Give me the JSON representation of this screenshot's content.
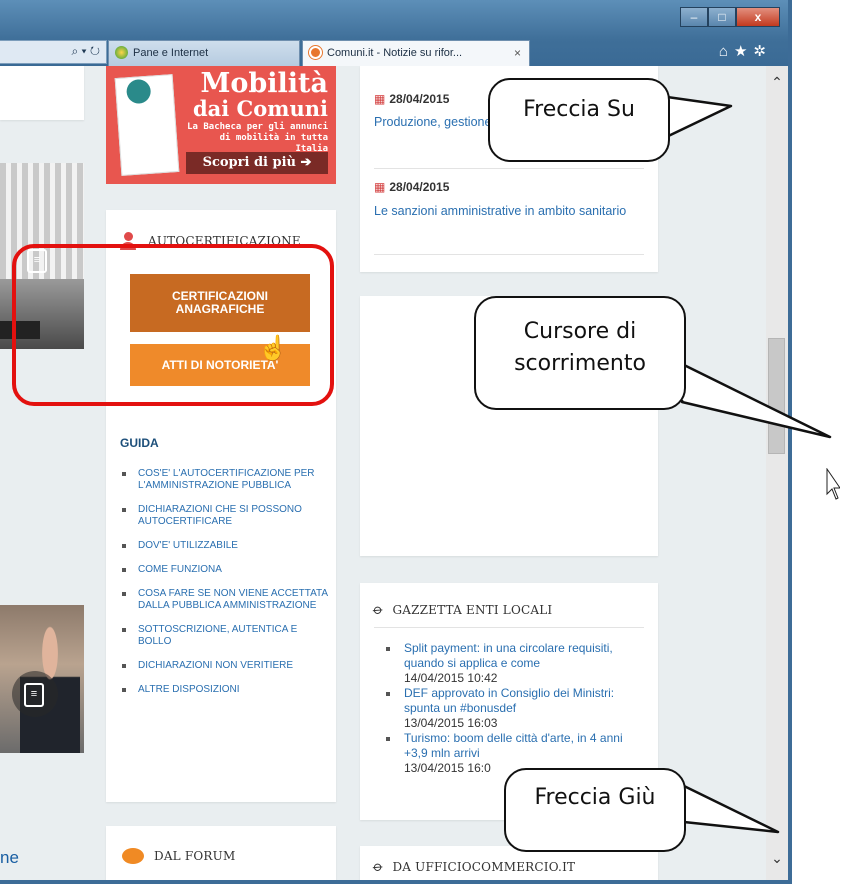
{
  "browser": {
    "address_icons": "⌕ ▾ ↻",
    "tabs": [
      {
        "label": "Pane e Internet",
        "active": false
      },
      {
        "label": "Comuni.it - Notizie su rifor...",
        "active": true,
        "close": "×"
      }
    ],
    "window_buttons": {
      "minimize": "–",
      "maximize": "□",
      "close": "x"
    },
    "toolbar_icons": [
      "home-icon",
      "star-icon",
      "gear-icon"
    ]
  },
  "left_column": {
    "bottom_link": "ne"
  },
  "banner": {
    "title_line1": "Mobilità",
    "title_line2": "dai Comuni",
    "subtitle": "La Bacheca per gli annunci di mobilità in tutta Italia",
    "cta": "Scopri di più ➔",
    "color": "#e8564f"
  },
  "autocertificazione": {
    "title": "AUTOCERTIFICAZIONE",
    "button1": "CERTIFICAZIONI ANAGRAFICHE",
    "button2": "ATTI DI NOTORIETA'",
    "button1_color": "#c76a22",
    "button2_color": "#ef8a2a",
    "guida_title": "GUIDA",
    "guida_items": [
      "COS'E' L'AUTOCERTIFICAZIONE PER L'AMMINISTRAZIONE PUBBLICA",
      "DICHIARAZIONI CHE SI POSSONO AUTOCERTIFICARE",
      "DOV'E' UTILIZZABILE",
      "COME FUNZIONA",
      "COSA FARE SE NON VIENE ACCETTATA DALLA PUBBLICA AMMINISTRAZIONE",
      "SOTTOSCRIZIONE, AUTENTICA E BOLLO",
      "DICHIARAZIONI NON VERITIERE",
      "ALTRE DISPOSIZIONI"
    ]
  },
  "forum": {
    "title": "DAL FORUM"
  },
  "news": [
    {
      "date": "28/04/2015",
      "title": "Produzione, gestione documenti informatici"
    },
    {
      "date": "28/04/2015",
      "title": "Le sanzioni amministrative in ambito sanitario"
    }
  ],
  "gazzetta": {
    "title": "GAZZETTA ENTI LOCALI",
    "items": [
      {
        "title": "Split payment: in una circolare requisiti, quando si applica e come",
        "time": "14/04/2015 10:42"
      },
      {
        "title": "DEF approvato in Consiglio dei Ministri: spunta un #bonusdef",
        "time": "13/04/2015 16:03"
      },
      {
        "title": "Turismo: boom delle città d'arte, in 4 anni +3,9 mln arrivi",
        "time": "13/04/2015 16:0"
      }
    ]
  },
  "ufficio": {
    "title": "DA UFFICIOCOMMERCIO.IT"
  },
  "scrollbar": {
    "up_arrow": "⌃",
    "down_arrow": "⌄",
    "position_fraction": 0.34
  },
  "annotations": {
    "freccia_su": "Freccia Su",
    "cursore": "Cursore di scorrimento",
    "freccia_giu": "Freccia Giù",
    "highlight_color": "#e3110f"
  }
}
